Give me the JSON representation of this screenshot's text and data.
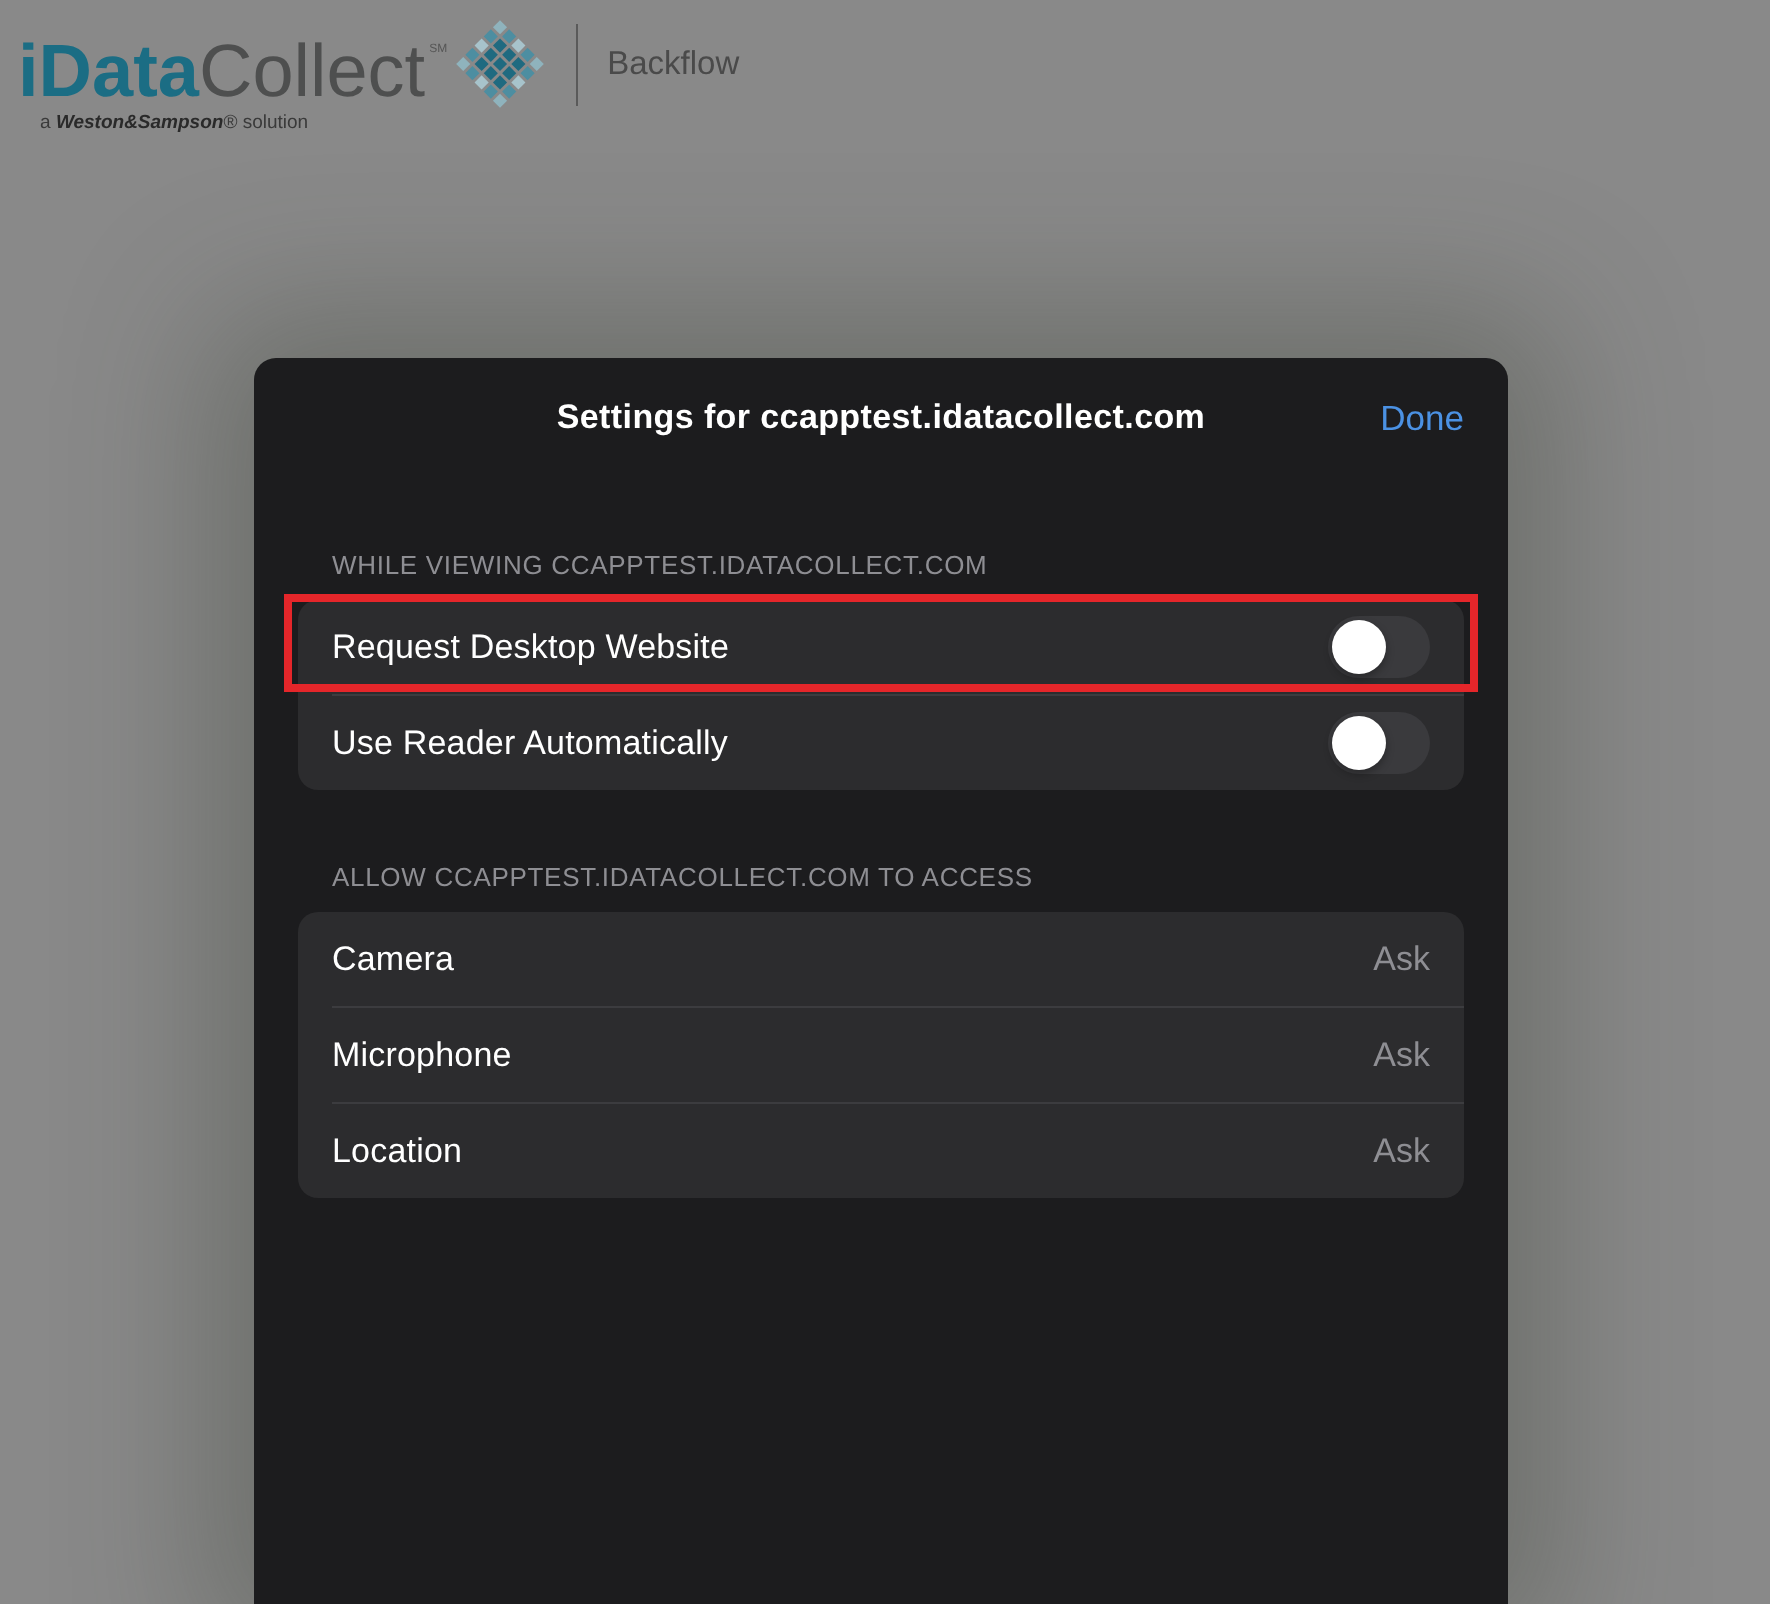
{
  "header": {
    "logo": {
      "wordmark": "**iData**Collect$^{SM}$",
      "tagline": "a *Weston&Sampson*® solution"
    },
    "app_name": "Backflow"
  },
  "sheet": {
    "title": "Settings for ccapptest.idatacollect.com",
    "done_button": "Done",
    "sections": [
      {
        "header": "WHILE VIEWING CCAPPTEST.IDATACOLLECT.COM",
        "rows": [
          {
            "kind": "toggle",
            "label": "Request Desktop Website",
            "on": false,
            "highlighted": true
          },
          {
            "kind": "toggle",
            "label": "Use Reader Automatically",
            "on": false,
            "highlighted": false
          }
        ]
      },
      {
        "header": "ALLOW CCAPPTEST.IDATACOLLECT.COM TO ACCESS",
        "rows": [
          {
            "kind": "value",
            "label": "Camera",
            "value": "Ask",
            "highlighted": false
          },
          {
            "kind": "value",
            "label": "Microphone",
            "value": "Ask",
            "highlighted": false
          },
          {
            "kind": "value",
            "label": "Location",
            "value": "Ask",
            "highlighted": false
          }
        ]
      }
    ]
  }
}
